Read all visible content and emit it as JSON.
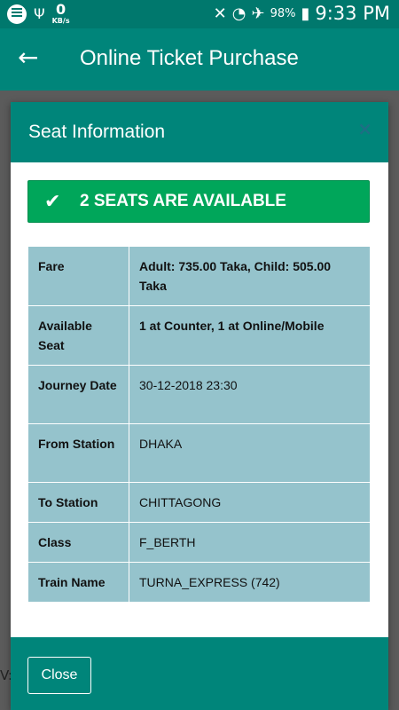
{
  "status_bar": {
    "net_speed": "0",
    "net_unit": "KB/s",
    "battery": "98%",
    "time": "9:33 PM"
  },
  "app_bar": {
    "title": "Online Ticket Purchase"
  },
  "background": {
    "partial_text": "V:"
  },
  "modal": {
    "title": "Seat Information",
    "close_icon": "×",
    "alert": {
      "message": "2 SEATS ARE AVAILABLE"
    },
    "rows": [
      {
        "label": "Fare",
        "value": "Adult: 735.00 Taka, Child: 505.00 Taka"
      },
      {
        "label": "Available Seat",
        "value": "1 at Counter, 1 at Online/Mobile"
      },
      {
        "label": "Journey Date",
        "value": "30-12-2018 23:30"
      },
      {
        "label": "From Station",
        "value": "DHAKA"
      },
      {
        "label": "To Station",
        "value": "CHITTAGONG"
      },
      {
        "label": "Class",
        "value": "F_BERTH"
      },
      {
        "label": "Train Name",
        "value": "TURNA_EXPRESS (742)"
      }
    ],
    "close_button": "Close"
  },
  "colors": {
    "teal_dark": "#00786d",
    "teal": "#00857a",
    "success": "#00a65a",
    "table_bg": "#95c3cc"
  }
}
